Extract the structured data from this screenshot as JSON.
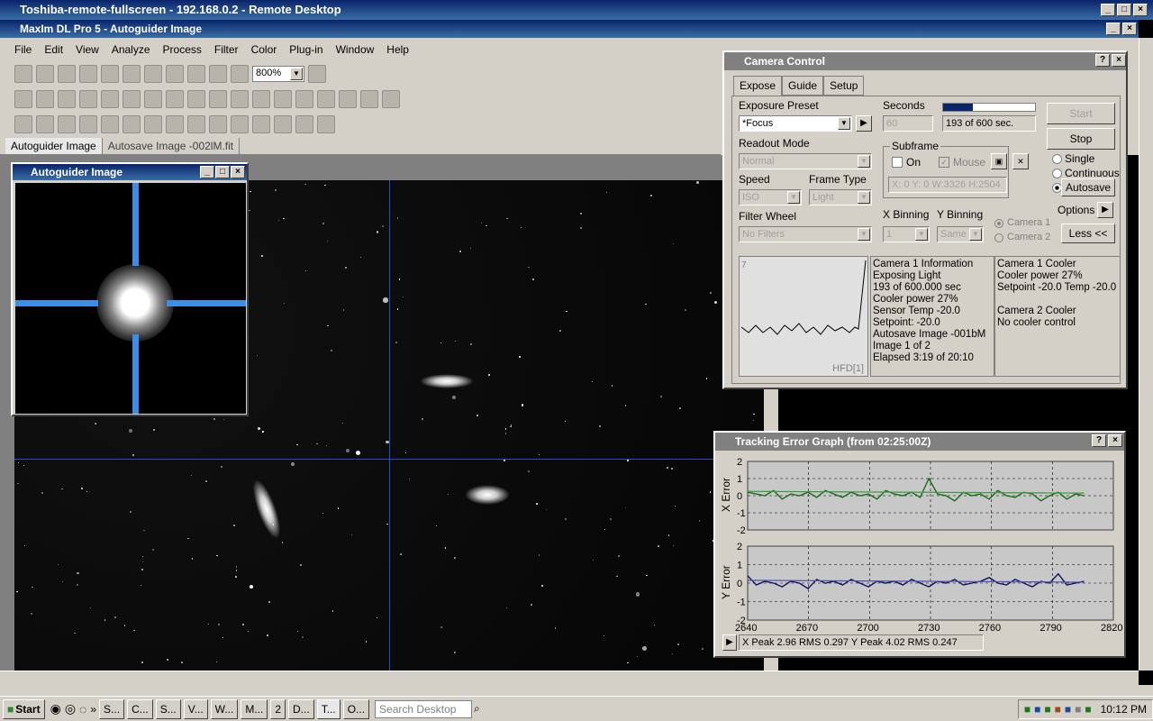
{
  "rdp": {
    "title": "Toshiba-remote-fullscreen - 192.168.0.2 - Remote Desktop"
  },
  "app": {
    "title": "MaxIm DL Pro 5 - Autoguider Image"
  },
  "menu": [
    "File",
    "Edit",
    "View",
    "Analyze",
    "Process",
    "Filter",
    "Color",
    "Plug-in",
    "Window",
    "Help"
  ],
  "toolbar": {
    "zoom": "800%"
  },
  "tabs": [
    "Autoguider Image",
    "Autosave Image -002lM.fit"
  ],
  "autoguider": {
    "title": "Autoguider Image"
  },
  "camera": {
    "title": "Camera Control",
    "tabs": [
      "Expose",
      "Guide",
      "Setup"
    ],
    "exposure_preset_label": "Exposure Preset",
    "exposure_preset_value": "*Focus",
    "seconds_label": "Seconds",
    "seconds_value": "60",
    "progress_text": "193 of 600 sec.",
    "progress_fraction": 0.32,
    "readout_label": "Readout Mode",
    "readout_value": "Normal",
    "subframe_label": "Subframe",
    "subframe_on": "On",
    "subframe_mouse": "Mouse",
    "subframe_coords": "X:    0 Y:    0 W:3326 H:2504",
    "speed_label": "Speed",
    "speed_value": "ISO",
    "frametype_label": "Frame Type",
    "frametype_value": "Light",
    "filter_label": "Filter Wheel",
    "filter_value": "No Filters",
    "xbin_label": "X Binning",
    "xbin_value": "1",
    "ybin_label": "Y Binning",
    "ybin_value": "Same",
    "cam1": "Camera 1",
    "cam2": "Camera 2",
    "start": "Start",
    "stop": "Stop",
    "single": "Single",
    "continuous": "Continuous",
    "autosave": "Autosave",
    "options": "Options",
    "less": "Less <<",
    "hfd_max": "7",
    "hfd_label": "HFD[1]",
    "info": [
      "Camera 1 Information",
      "Exposing Light",
      "193 of 600.000 sec",
      "Cooler power 27%",
      "Sensor Temp -20.0",
      "Setpoint: -20.0",
      "Autosave Image -001bM",
      "Image 1 of 2",
      "Elapsed 3:19 of 20:10"
    ],
    "cooler": [
      "Camera 1 Cooler",
      "Cooler power 27%",
      "Setpoint -20.0   Temp -20.0",
      "",
      "Camera 2 Cooler",
      "No cooler control"
    ]
  },
  "tracking": {
    "title": "Tracking Error Graph (from 02:25:00Z)",
    "xerr_label": "X Error",
    "yerr_label": "Y Error",
    "yticks": [
      "2",
      "1",
      "0",
      "-1",
      "-2"
    ],
    "xticks": [
      "2640",
      "2670",
      "2700",
      "2730",
      "2760",
      "2790",
      "2820"
    ],
    "status": "X Peak 2.96   RMS 0.297    Y Peak 4.02   RMS 0.247"
  },
  "taskbar": {
    "start": "Start",
    "items": [
      "S...",
      "C...",
      "S...",
      "V...",
      "W...",
      "M...",
      "2",
      "D...",
      "T...",
      "O..."
    ],
    "search": "Search Desktop",
    "clock": "10:12 PM"
  },
  "chart_data": [
    {
      "type": "line",
      "title": "X Error",
      "x_range": [
        2640,
        2820
      ],
      "ylim": [
        -2,
        2
      ],
      "series": [
        {
          "values": [
            0.2,
            0.1,
            0.0,
            0.3,
            -0.2,
            0.1,
            0.0,
            0.2,
            -0.1,
            0.3,
            0.1,
            -0.1,
            0.2,
            0.0,
            0.1,
            -0.2,
            0.3,
            0.1,
            0.0,
            0.2,
            -0.1,
            1.0,
            0.1,
            0.0,
            -0.3,
            0.2,
            0.0,
            0.1,
            -0.2,
            0.3,
            0.0,
            -0.1,
            0.2,
            0.1,
            -0.3,
            0.0,
            0.2,
            -0.2,
            0.1,
            0.0
          ]
        }
      ]
    },
    {
      "type": "line",
      "title": "Y Error",
      "x_range": [
        2640,
        2820
      ],
      "ylim": [
        -2,
        2
      ],
      "series": [
        {
          "values": [
            0.4,
            -0.1,
            0.1,
            0.0,
            -0.2,
            0.1,
            0.0,
            -0.3,
            0.2,
            0.0,
            0.1,
            -0.1,
            0.2,
            0.0,
            -0.2,
            0.1,
            0.0,
            0.1,
            -0.1,
            0.2,
            0.0,
            -0.2,
            0.1,
            0.0,
            0.2,
            -0.1,
            0.0,
            0.1,
            0.3,
            0.0,
            -0.1,
            0.2,
            0.0,
            -0.2,
            0.1,
            0.0,
            0.5,
            -0.1,
            0.0,
            0.1
          ]
        }
      ]
    }
  ]
}
